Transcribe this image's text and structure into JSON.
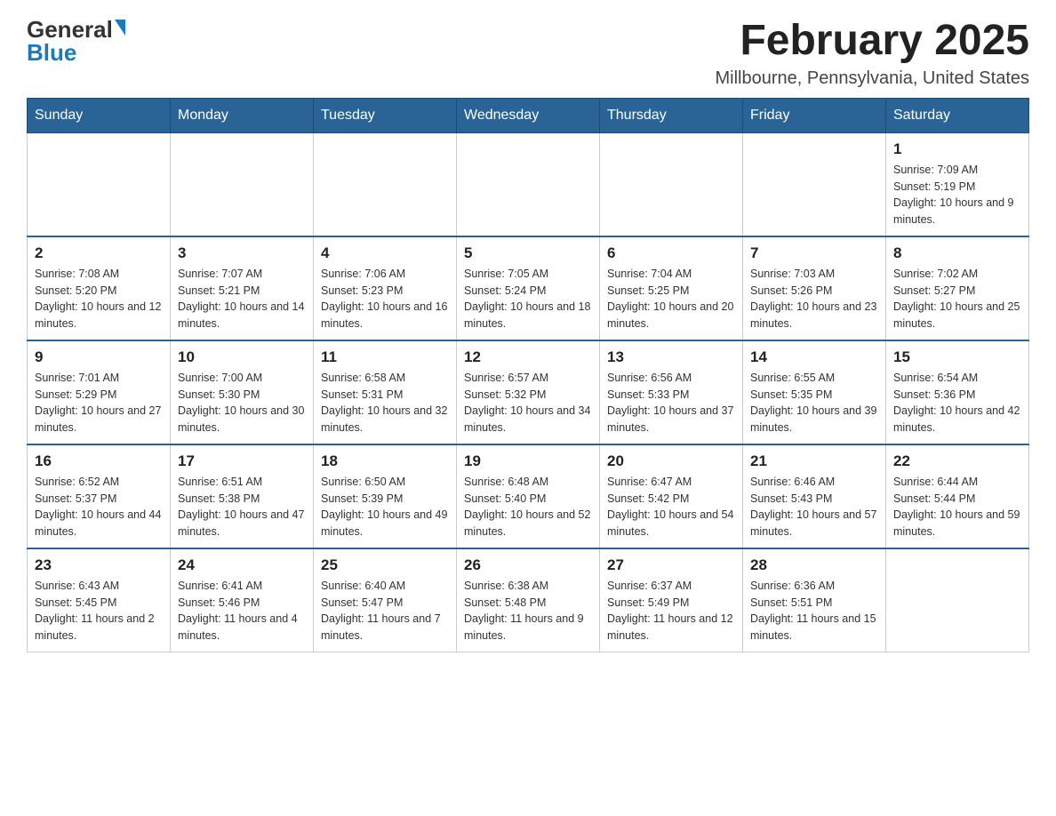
{
  "header": {
    "logo_general": "General",
    "logo_blue": "Blue",
    "month_year": "February 2025",
    "location": "Millbourne, Pennsylvania, United States"
  },
  "days_of_week": [
    "Sunday",
    "Monday",
    "Tuesday",
    "Wednesday",
    "Thursday",
    "Friday",
    "Saturday"
  ],
  "weeks": [
    [
      {
        "day": "",
        "info": ""
      },
      {
        "day": "",
        "info": ""
      },
      {
        "day": "",
        "info": ""
      },
      {
        "day": "",
        "info": ""
      },
      {
        "day": "",
        "info": ""
      },
      {
        "day": "",
        "info": ""
      },
      {
        "day": "1",
        "info": "Sunrise: 7:09 AM\nSunset: 5:19 PM\nDaylight: 10 hours and 9 minutes."
      }
    ],
    [
      {
        "day": "2",
        "info": "Sunrise: 7:08 AM\nSunset: 5:20 PM\nDaylight: 10 hours and 12 minutes."
      },
      {
        "day": "3",
        "info": "Sunrise: 7:07 AM\nSunset: 5:21 PM\nDaylight: 10 hours and 14 minutes."
      },
      {
        "day": "4",
        "info": "Sunrise: 7:06 AM\nSunset: 5:23 PM\nDaylight: 10 hours and 16 minutes."
      },
      {
        "day": "5",
        "info": "Sunrise: 7:05 AM\nSunset: 5:24 PM\nDaylight: 10 hours and 18 minutes."
      },
      {
        "day": "6",
        "info": "Sunrise: 7:04 AM\nSunset: 5:25 PM\nDaylight: 10 hours and 20 minutes."
      },
      {
        "day": "7",
        "info": "Sunrise: 7:03 AM\nSunset: 5:26 PM\nDaylight: 10 hours and 23 minutes."
      },
      {
        "day": "8",
        "info": "Sunrise: 7:02 AM\nSunset: 5:27 PM\nDaylight: 10 hours and 25 minutes."
      }
    ],
    [
      {
        "day": "9",
        "info": "Sunrise: 7:01 AM\nSunset: 5:29 PM\nDaylight: 10 hours and 27 minutes."
      },
      {
        "day": "10",
        "info": "Sunrise: 7:00 AM\nSunset: 5:30 PM\nDaylight: 10 hours and 30 minutes."
      },
      {
        "day": "11",
        "info": "Sunrise: 6:58 AM\nSunset: 5:31 PM\nDaylight: 10 hours and 32 minutes."
      },
      {
        "day": "12",
        "info": "Sunrise: 6:57 AM\nSunset: 5:32 PM\nDaylight: 10 hours and 34 minutes."
      },
      {
        "day": "13",
        "info": "Sunrise: 6:56 AM\nSunset: 5:33 PM\nDaylight: 10 hours and 37 minutes."
      },
      {
        "day": "14",
        "info": "Sunrise: 6:55 AM\nSunset: 5:35 PM\nDaylight: 10 hours and 39 minutes."
      },
      {
        "day": "15",
        "info": "Sunrise: 6:54 AM\nSunset: 5:36 PM\nDaylight: 10 hours and 42 minutes."
      }
    ],
    [
      {
        "day": "16",
        "info": "Sunrise: 6:52 AM\nSunset: 5:37 PM\nDaylight: 10 hours and 44 minutes."
      },
      {
        "day": "17",
        "info": "Sunrise: 6:51 AM\nSunset: 5:38 PM\nDaylight: 10 hours and 47 minutes."
      },
      {
        "day": "18",
        "info": "Sunrise: 6:50 AM\nSunset: 5:39 PM\nDaylight: 10 hours and 49 minutes."
      },
      {
        "day": "19",
        "info": "Sunrise: 6:48 AM\nSunset: 5:40 PM\nDaylight: 10 hours and 52 minutes."
      },
      {
        "day": "20",
        "info": "Sunrise: 6:47 AM\nSunset: 5:42 PM\nDaylight: 10 hours and 54 minutes."
      },
      {
        "day": "21",
        "info": "Sunrise: 6:46 AM\nSunset: 5:43 PM\nDaylight: 10 hours and 57 minutes."
      },
      {
        "day": "22",
        "info": "Sunrise: 6:44 AM\nSunset: 5:44 PM\nDaylight: 10 hours and 59 minutes."
      }
    ],
    [
      {
        "day": "23",
        "info": "Sunrise: 6:43 AM\nSunset: 5:45 PM\nDaylight: 11 hours and 2 minutes."
      },
      {
        "day": "24",
        "info": "Sunrise: 6:41 AM\nSunset: 5:46 PM\nDaylight: 11 hours and 4 minutes."
      },
      {
        "day": "25",
        "info": "Sunrise: 6:40 AM\nSunset: 5:47 PM\nDaylight: 11 hours and 7 minutes."
      },
      {
        "day": "26",
        "info": "Sunrise: 6:38 AM\nSunset: 5:48 PM\nDaylight: 11 hours and 9 minutes."
      },
      {
        "day": "27",
        "info": "Sunrise: 6:37 AM\nSunset: 5:49 PM\nDaylight: 11 hours and 12 minutes."
      },
      {
        "day": "28",
        "info": "Sunrise: 6:36 AM\nSunset: 5:51 PM\nDaylight: 11 hours and 15 minutes."
      },
      {
        "day": "",
        "info": ""
      }
    ]
  ]
}
